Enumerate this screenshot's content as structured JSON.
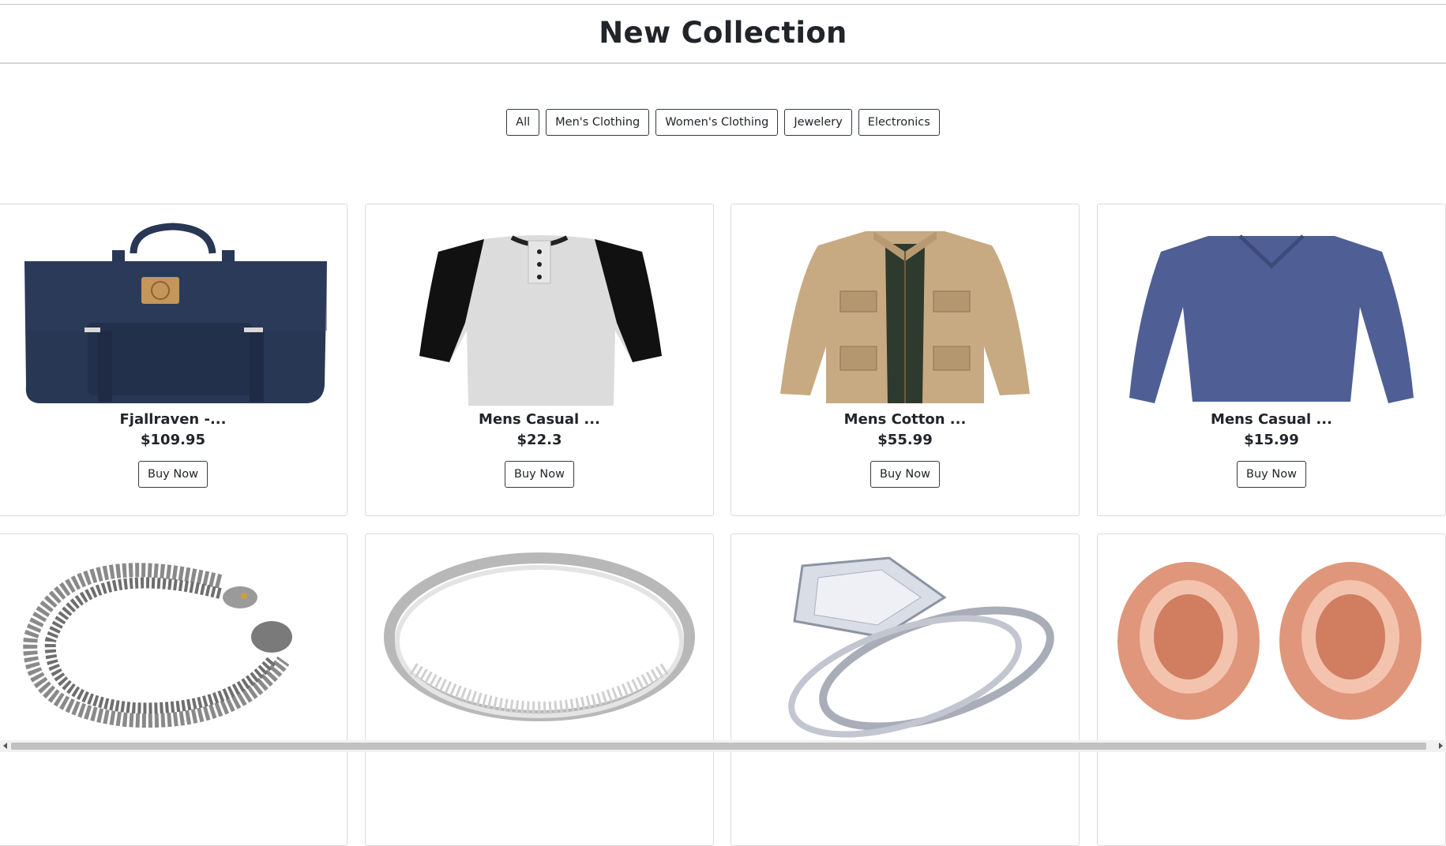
{
  "page": {
    "title": "New Collection"
  },
  "filters": [
    "All",
    "Men's Clothing",
    "Women's Clothing",
    "Jewelery",
    "Electronics"
  ],
  "products": [
    {
      "name": "Fjallraven -...",
      "price": "$109.95",
      "button": "Buy Now",
      "image": "backpack-image"
    },
    {
      "name": "Mens Casual ...",
      "price": "$22.3",
      "button": "Buy Now",
      "image": "raglan-tshirt-image"
    },
    {
      "name": "Mens Cotton ...",
      "price": "$55.99",
      "button": "Buy Now",
      "image": "cotton-jacket-image"
    },
    {
      "name": "Mens Casual ...",
      "price": "$15.99",
      "button": "Buy Now",
      "image": "slim-fit-tshirt-image"
    },
    {
      "name": "",
      "price": "",
      "button": "",
      "image": "chain-bracelet-image"
    },
    {
      "name": "",
      "price": "",
      "button": "",
      "image": "silver-ring-image"
    },
    {
      "name": "",
      "price": "",
      "button": "",
      "image": "princess-ring-image"
    },
    {
      "name": "",
      "price": "",
      "button": "",
      "image": "rose-gold-plugs-image"
    }
  ],
  "colors": {
    "navy": "#283754",
    "border": "#dcdcdc",
    "text": "#212529",
    "khaki": "#c7aa82",
    "rose_gold": "#e0967a",
    "denim": "#4f5f95"
  }
}
